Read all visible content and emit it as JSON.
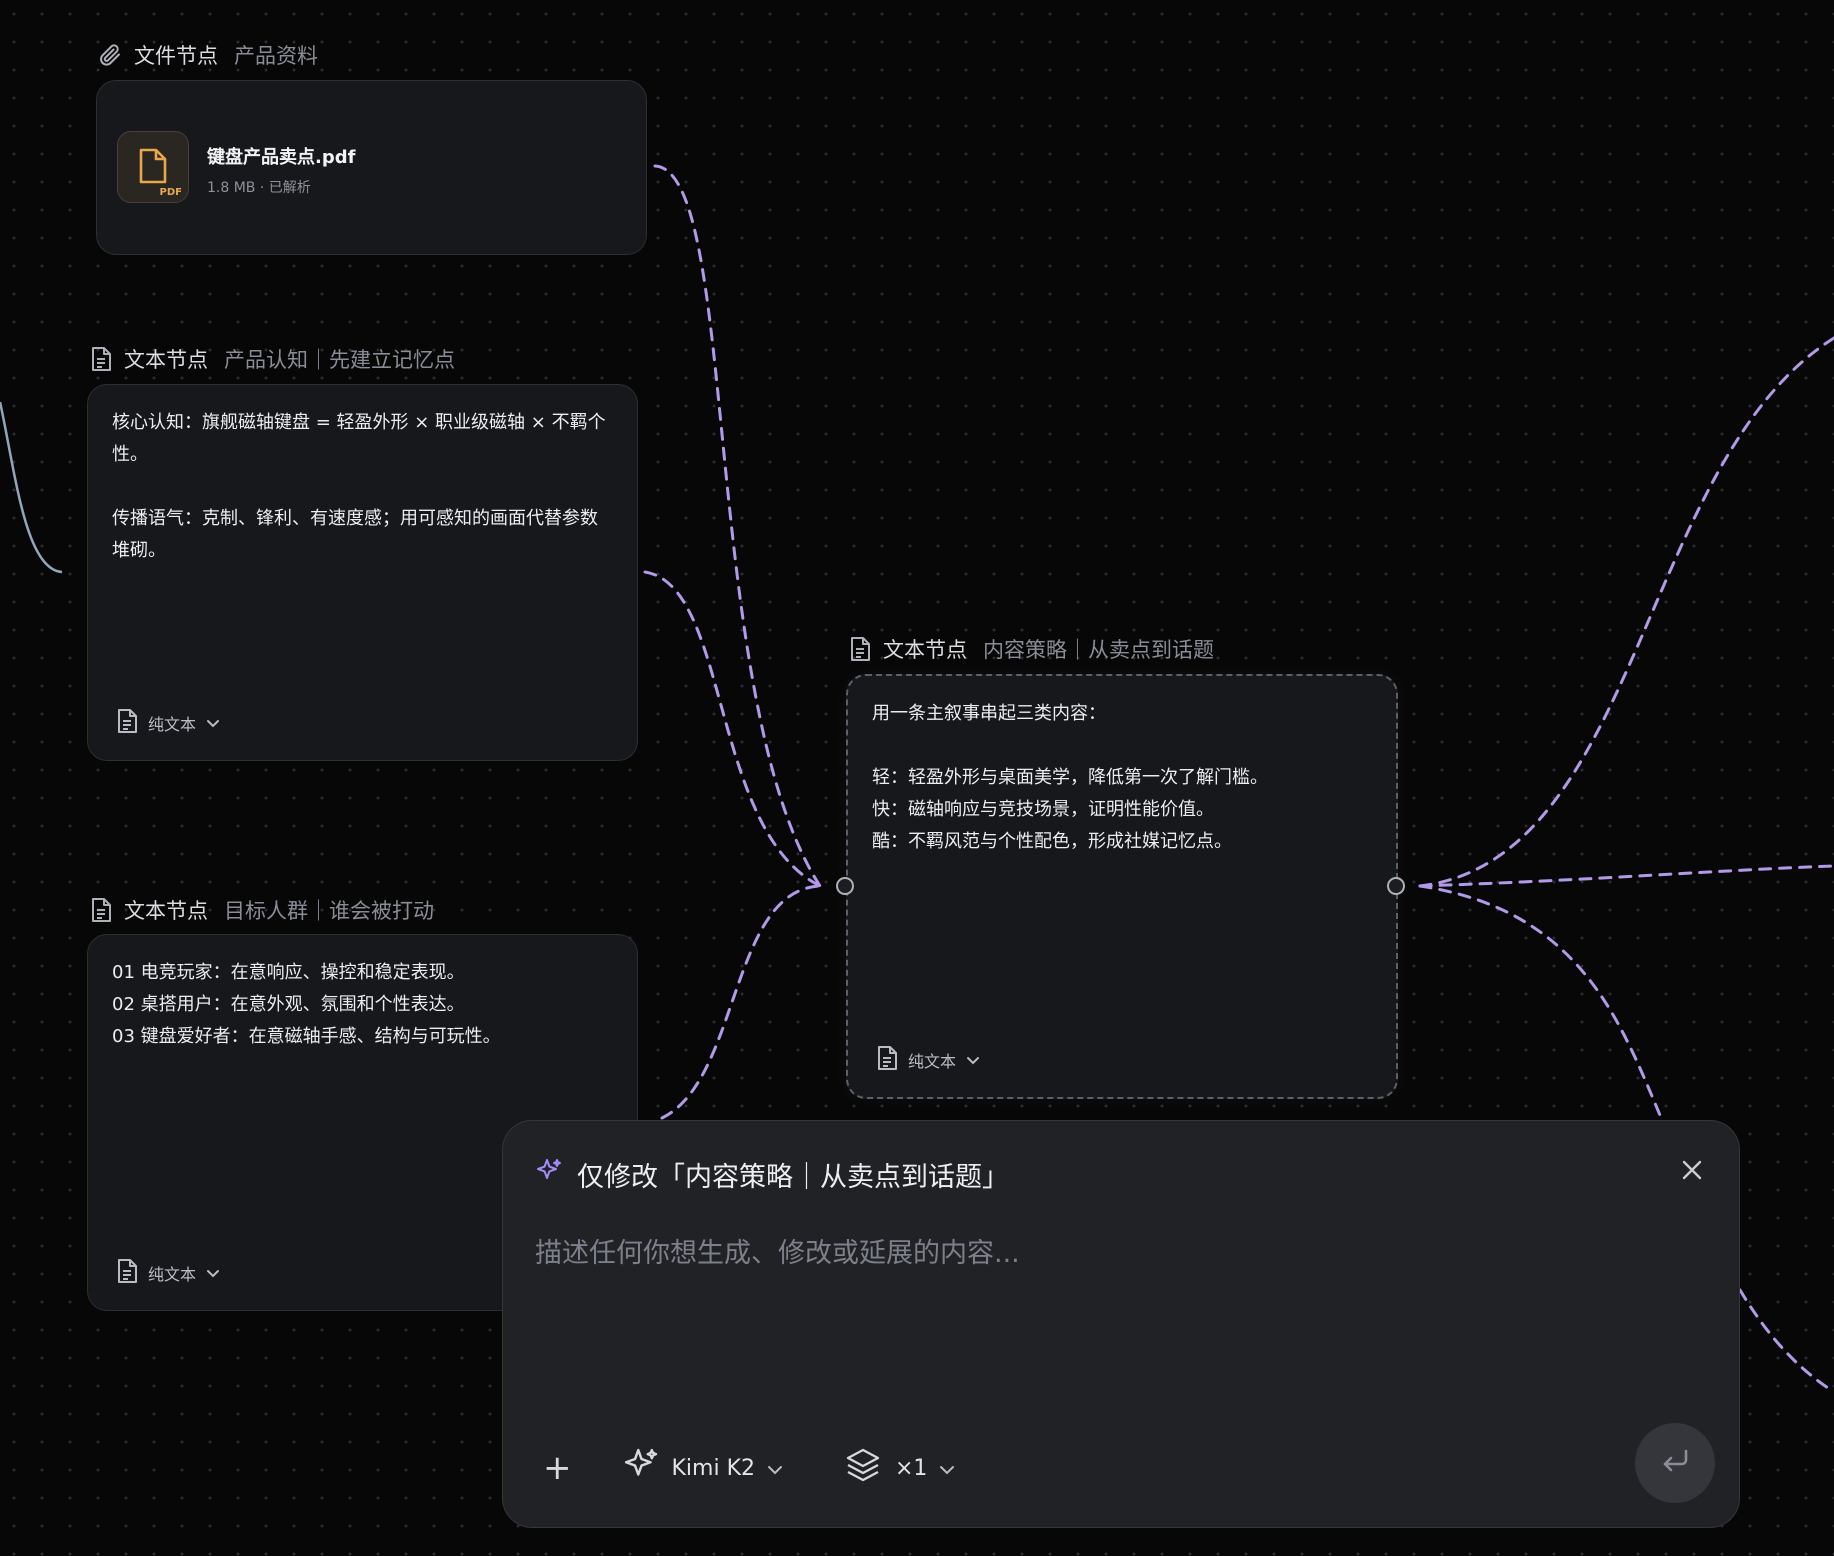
{
  "canvas": {
    "file_node": {
      "type_label": "文件节点",
      "title": "产品资料",
      "file_name": "键盘产品卖点.pdf",
      "file_meta": "1.8 MB · 已解析",
      "badge": "PDF",
      "icon": "paperclip-icon"
    },
    "text_nodes": [
      {
        "type_label": "文本节点",
        "title": "产品认知｜先建立记忆点",
        "content": "核心认知：旗舰磁轴键盘 = 轻盈外形 × 职业级磁轴 × 不羁个性。\n\n传播语气：克制、锋利、有速度感；用可感知的画面代替参数堆砌。",
        "format": "纯文本"
      },
      {
        "type_label": "文本节点",
        "title": "目标人群｜谁会被打动",
        "content": "01 电竞玩家：在意响应、操控和稳定表现。\n02 桌搭用户：在意外观、氛围和个性表达。\n03 键盘爱好者：在意磁轴手感、结构与可玩性。",
        "format": "纯文本"
      },
      {
        "type_label": "文本节点",
        "title": "内容策略｜从卖点到话题",
        "content": "用一条主叙事串起三类内容：\n\n轻：轻盈外形与桌面美学，降低第一次了解门槛。\n快：磁轴响应与竞技场景，证明性能价值。\n酷：不羁风范与个性配色，形成社媒记忆点。",
        "format": "纯文本",
        "selected": true
      }
    ],
    "edge_color": "#b39ae8"
  },
  "ai_panel": {
    "title": "仅修改「内容策略｜从卖点到话题」",
    "placeholder": "描述任何你想生成、修改或延展的内容...",
    "add_label": "+",
    "model": "Kimi K2",
    "count": "×1",
    "accent": "#a78bfa"
  }
}
